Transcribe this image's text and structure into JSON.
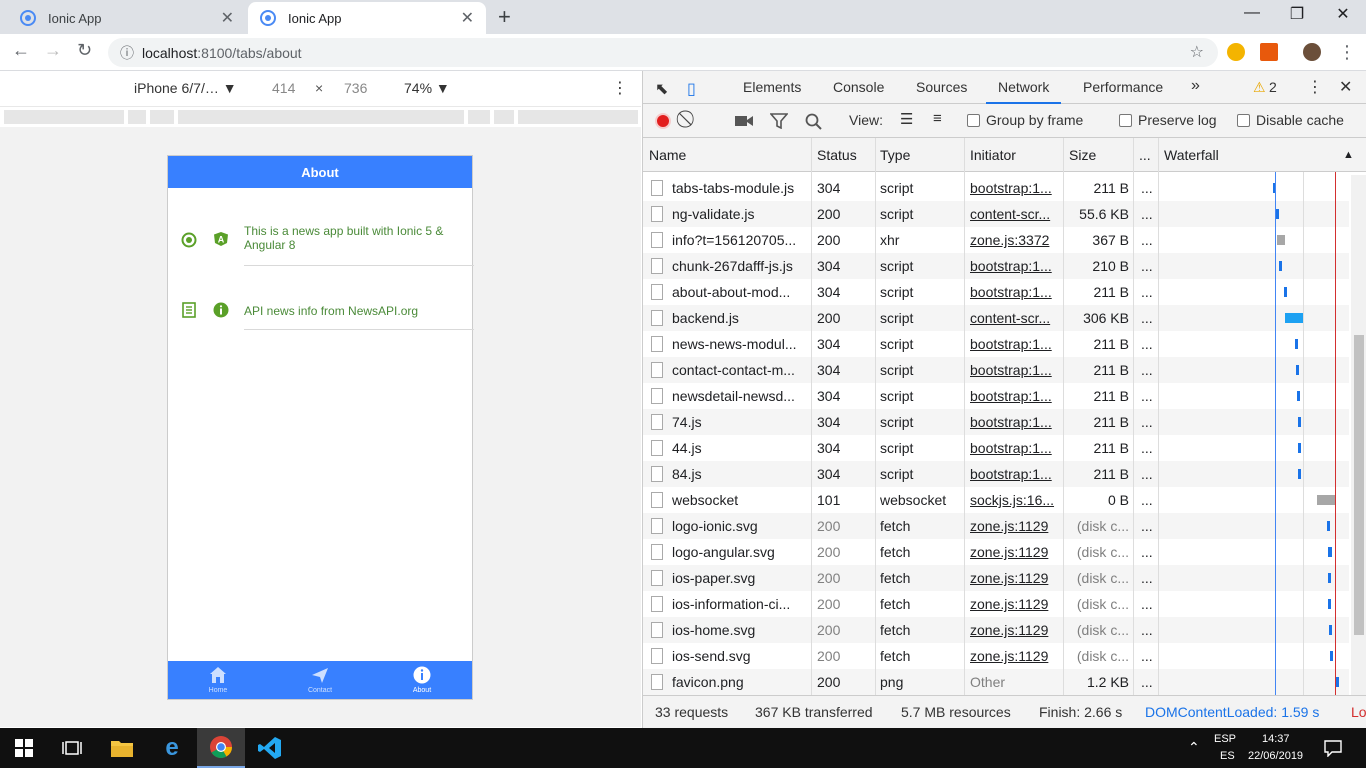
{
  "browser": {
    "tabs": [
      {
        "title": "Ionic App",
        "active": false
      },
      {
        "title": "Ionic App",
        "active": true
      }
    ],
    "url_host": "localhost",
    "url_path": ":8100/tabs/about",
    "new_tab": "+",
    "win_min": "—",
    "win_max": "❐",
    "win_close": "✕"
  },
  "device_toolbar": {
    "device": "iPhone 6/7/…",
    "width": "414",
    "times": "×",
    "height": "736",
    "zoom": "74%"
  },
  "phone": {
    "header_title": "About",
    "items": [
      {
        "text": "This is a news app built with Ionic 5 & Angular 8",
        "icon1": "ionic-logo-icon",
        "icon2": "angular-logo-icon"
      },
      {
        "text": "API news info from NewsAPI.org",
        "icon1": "paper-icon",
        "icon2": "information-circle-icon"
      }
    ],
    "tabs": [
      {
        "label": "Home",
        "icon": "home-icon"
      },
      {
        "label": "Contact",
        "icon": "send-icon"
      },
      {
        "label": "About",
        "icon": "information-icon"
      }
    ]
  },
  "devtools": {
    "tabs": [
      "Elements",
      "Console",
      "Sources",
      "Network",
      "Performance"
    ],
    "more_tabs": "»",
    "active_tab": "Network",
    "warnings": "2",
    "view_label": "View:",
    "group_by_frame": "Group by frame",
    "preserve_log": "Preserve log",
    "disable_cache": "Disable cache",
    "columns": {
      "name": "Name",
      "status": "Status",
      "type": "Type",
      "initiator": "Initiator",
      "size": "Size",
      "time": "...",
      "waterfall": "Waterfall"
    },
    "rows": [
      {
        "name": "tabs-tabs-module.js",
        "status": "304",
        "type": "script",
        "initiator": "bootstrap:1...",
        "size": "211 B",
        "time": "...",
        "cached": false
      },
      {
        "name": "ng-validate.js",
        "status": "200",
        "type": "script",
        "initiator": "content-scr...",
        "size": "55.6 KB",
        "time": "...",
        "cached": false
      },
      {
        "name": "info?t=156120705...",
        "status": "200",
        "type": "xhr",
        "initiator": "zone.js:3372",
        "size": "367 B",
        "time": "...",
        "cached": false
      },
      {
        "name": "chunk-267dafff-js.js",
        "status": "304",
        "type": "script",
        "initiator": "bootstrap:1...",
        "size": "210 B",
        "time": "...",
        "cached": false
      },
      {
        "name": "about-about-mod...",
        "status": "304",
        "type": "script",
        "initiator": "bootstrap:1...",
        "size": "211 B",
        "time": "...",
        "cached": false
      },
      {
        "name": "backend.js",
        "status": "200",
        "type": "script",
        "initiator": "content-scr...",
        "size": "306 KB",
        "time": "...",
        "cached": false
      },
      {
        "name": "news-news-modul...",
        "status": "304",
        "type": "script",
        "initiator": "bootstrap:1...",
        "size": "211 B",
        "time": "...",
        "cached": false
      },
      {
        "name": "contact-contact-m...",
        "status": "304",
        "type": "script",
        "initiator": "bootstrap:1...",
        "size": "211 B",
        "time": "...",
        "cached": false
      },
      {
        "name": "newsdetail-newsd...",
        "status": "304",
        "type": "script",
        "initiator": "bootstrap:1...",
        "size": "211 B",
        "time": "...",
        "cached": false
      },
      {
        "name": "74.js",
        "status": "304",
        "type": "script",
        "initiator": "bootstrap:1...",
        "size": "211 B",
        "time": "...",
        "cached": false
      },
      {
        "name": "44.js",
        "status": "304",
        "type": "script",
        "initiator": "bootstrap:1...",
        "size": "211 B",
        "time": "...",
        "cached": false
      },
      {
        "name": "84.js",
        "status": "304",
        "type": "script",
        "initiator": "bootstrap:1...",
        "size": "211 B",
        "time": "...",
        "cached": false
      },
      {
        "name": "websocket",
        "status": "101",
        "type": "websocket",
        "initiator": "sockjs.js:16...",
        "size": "0 B",
        "time": "...",
        "cached": false
      },
      {
        "name": "logo-ionic.svg",
        "status": "200",
        "type": "fetch",
        "initiator": "zone.js:1129",
        "size": "(disk c...",
        "time": "...",
        "cached": true
      },
      {
        "name": "logo-angular.svg",
        "status": "200",
        "type": "fetch",
        "initiator": "zone.js:1129",
        "size": "(disk c...",
        "time": "...",
        "cached": true
      },
      {
        "name": "ios-paper.svg",
        "status": "200",
        "type": "fetch",
        "initiator": "zone.js:1129",
        "size": "(disk c...",
        "time": "...",
        "cached": true
      },
      {
        "name": "ios-information-ci...",
        "status": "200",
        "type": "fetch",
        "initiator": "zone.js:1129",
        "size": "(disk c...",
        "time": "...",
        "cached": true
      },
      {
        "name": "ios-home.svg",
        "status": "200",
        "type": "fetch",
        "initiator": "zone.js:1129",
        "size": "(disk c...",
        "time": "...",
        "cached": true
      },
      {
        "name": "ios-send.svg",
        "status": "200",
        "type": "fetch",
        "initiator": "zone.js:1129",
        "size": "(disk c...",
        "time": "...",
        "cached": true
      },
      {
        "name": "favicon.png",
        "status": "200",
        "type": "png",
        "initiator": "Other",
        "size": "1.2 KB",
        "time": "...",
        "cached": false
      }
    ],
    "status": {
      "requests": "33 requests",
      "transferred": "367 KB transferred",
      "resources": "5.7 MB resources",
      "finish": "Finish: 2.66 s",
      "dom": "DOMContentLoaded: 1.59 s",
      "load": "Lo"
    }
  },
  "taskbar": {
    "lang": "ESP",
    "layout": "ES",
    "time": "14:37",
    "date": "22/06/2019"
  }
}
